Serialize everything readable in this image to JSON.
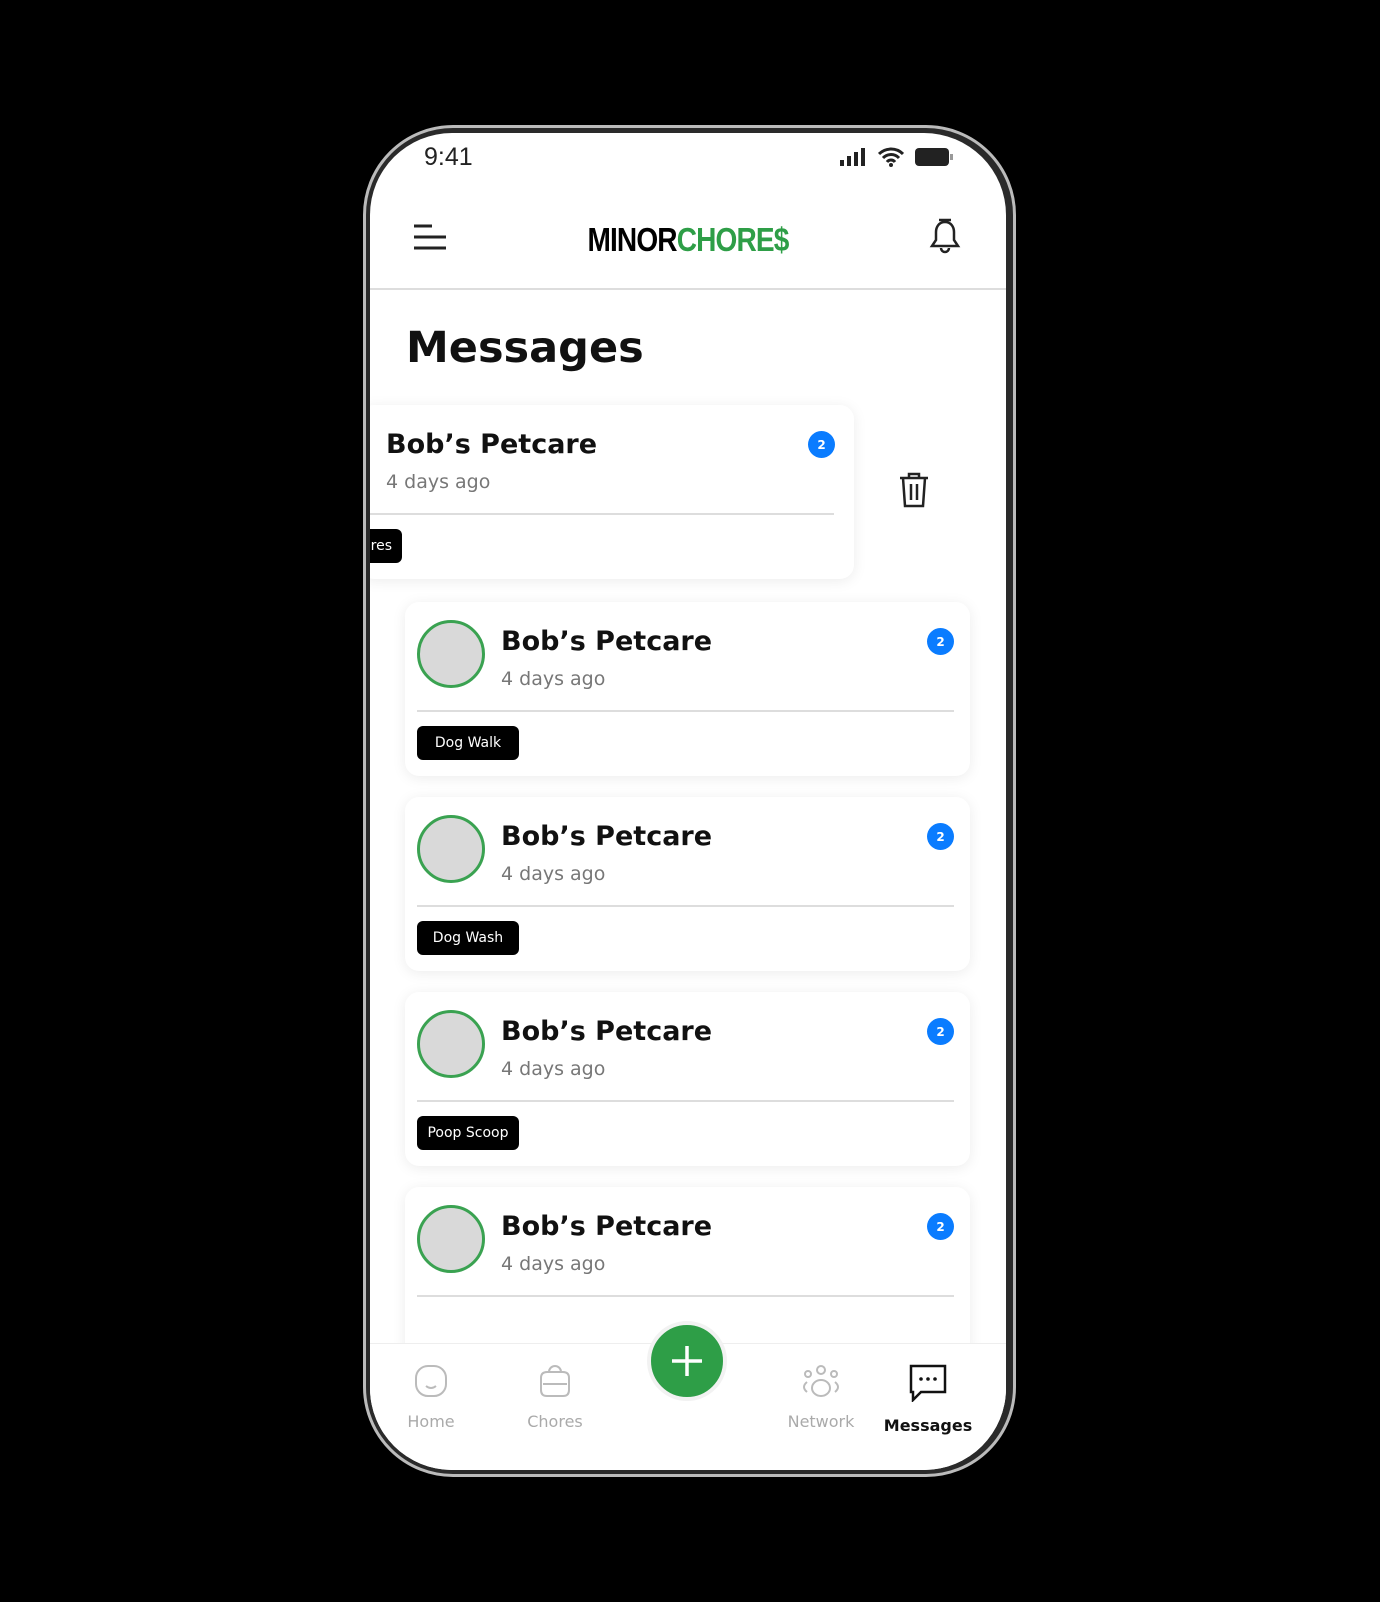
{
  "status": {
    "time": "9:41"
  },
  "header": {
    "logo_part1": "MINOR",
    "logo_part2": "CHORE$"
  },
  "page": {
    "title": "Messages"
  },
  "swiped": {
    "name": "Bob’s Petcare",
    "time": "4 days ago",
    "badge": "2",
    "tag": "res"
  },
  "messages": [
    {
      "name": "Bob’s Petcare",
      "time": "4 days ago",
      "badge": "2",
      "tag": "Dog Walk"
    },
    {
      "name": "Bob’s Petcare",
      "time": "4 days ago",
      "badge": "2",
      "tag": "Dog Wash"
    },
    {
      "name": "Bob’s Petcare",
      "time": "4 days ago",
      "badge": "2",
      "tag": "Poop Scoop"
    },
    {
      "name": "Bob’s Petcare",
      "time": "4 days ago",
      "badge": "2"
    }
  ],
  "nav": {
    "home": "Home",
    "chores": "Chores",
    "network": "Network",
    "messages": "Messages"
  },
  "colors": {
    "brand_green": "#2e9e47",
    "badge_blue": "#0a7cff"
  }
}
